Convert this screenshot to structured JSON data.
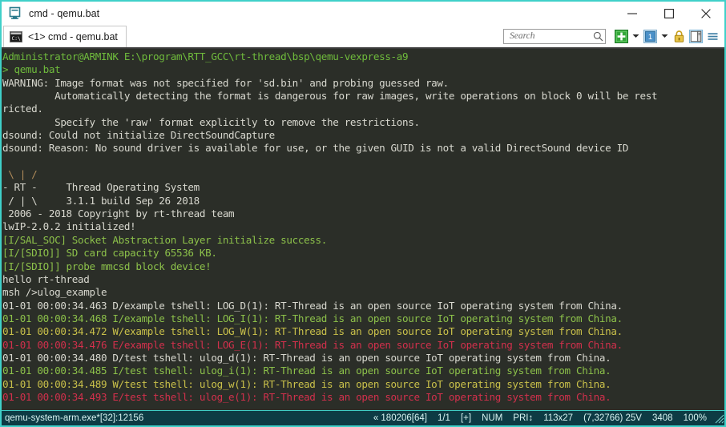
{
  "window": {
    "title": "cmd - qemu.bat",
    "icon": "console-app-icon",
    "border_color": "#3fd0c9",
    "controls": {
      "minimize": "—",
      "maximize": "□",
      "close": "✕"
    }
  },
  "tab": {
    "label": "<1> cmd - qemu.bat",
    "icon": "cmd-console-icon"
  },
  "toolbar": {
    "search": {
      "placeholder": "Search",
      "value": "",
      "icon": "search-magnifier-icon"
    },
    "new_tab": {
      "icon": "green-plus-icon",
      "caret": "▾"
    },
    "window_select": {
      "icon": "window-one-icon",
      "label": "1",
      "caret": "▾"
    },
    "lock": {
      "icon": "padlock-icon"
    },
    "panel": {
      "icon": "split-panel-icon"
    },
    "menu": {
      "icon": "hamburger-menu-icon"
    }
  },
  "terminal": {
    "background": "#2b2e28",
    "lines": [
      {
        "text": "Administrator@ARMINK E:\\program\\RTT_GCC\\rt-thread\\bsp\\qemu-vexpress-a9",
        "color": "green"
      },
      {
        "text": "> qemu.bat",
        "color": "green"
      },
      {
        "text": "WARNING: Image format was not specified for 'sd.bin' and probing guessed raw.",
        "color": "white"
      },
      {
        "text": "         Automatically detecting the format is dangerous for raw images, write operations on block 0 will be rest",
        "color": "white"
      },
      {
        "text": "ricted.",
        "color": "white"
      },
      {
        "text": "         Specify the 'raw' format explicitly to remove the restrictions.",
        "color": "white"
      },
      {
        "text": "dsound: Could not initialize DirectSoundCapture",
        "color": "white"
      },
      {
        "text": "dsound: Reason: No sound driver is available for use, or the given GUID is not a valid DirectSound device ID",
        "color": "white"
      },
      {
        "text": "",
        "color": "white"
      },
      {
        "text": " \\ | /",
        "color": "tan"
      },
      {
        "text": "- RT -     Thread Operating System",
        "color": "white"
      },
      {
        "text": " / | \\     3.1.1 build Sep 26 2018",
        "color": "white"
      },
      {
        "text": " 2006 - 2018 Copyright by rt-thread team",
        "color": "white"
      },
      {
        "text": "lwIP-2.0.2 initialized!",
        "color": "white"
      },
      {
        "text": "[I/SAL_SOC] Socket Abstraction Layer initialize success.",
        "color": "ygreen"
      },
      {
        "text": "[I/[SDIO]] SD card capacity 65536 KB.",
        "color": "ygreen"
      },
      {
        "text": "[I/[SDIO]] probe mmcsd block device!",
        "color": "ygreen"
      },
      {
        "text": "hello rt-thread",
        "color": "white"
      },
      {
        "text": "msh />ulog_example",
        "color": "white"
      },
      {
        "text": "01-01 00:00:34.463 D/example tshell: LOG_D(1): RT-Thread is an open source IoT operating system from China.",
        "color": "white"
      },
      {
        "text": "01-01 00:00:34.468 I/example tshell: LOG_I(1): RT-Thread is an open source IoT operating system from China.",
        "color": "ygreen"
      },
      {
        "text": "01-01 00:00:34.472 W/example tshell: LOG_W(1): RT-Thread is an open source IoT operating system from China.",
        "color": "yellow"
      },
      {
        "text": "01-01 00:00:34.476 E/example tshell: LOG_E(1): RT-Thread is an open source IoT operating system from China.",
        "color": "red"
      },
      {
        "text": "01-01 00:00:34.480 D/test tshell: ulog_d(1): RT-Thread is an open source IoT operating system from China.",
        "color": "white"
      },
      {
        "text": "01-01 00:00:34.485 I/test tshell: ulog_i(1): RT-Thread is an open source IoT operating system from China.",
        "color": "ygreen"
      },
      {
        "text": "01-01 00:00:34.489 W/test tshell: ulog_w(1): RT-Thread is an open source IoT operating system from China.",
        "color": "yellow"
      },
      {
        "text": "01-01 00:00:34.493 E/test tshell: ulog_e(1): RT-Thread is an open source IoT operating system from China.",
        "color": "red"
      }
    ]
  },
  "statusbar": {
    "process": "qemu-system-arm.exe*[32]:12156",
    "fields": [
      "« 180206[64]",
      "1/1",
      "[+]",
      "NUM",
      "PRI↕",
      "113x27",
      "(7,32766) 25V",
      "3408",
      "100%"
    ]
  }
}
